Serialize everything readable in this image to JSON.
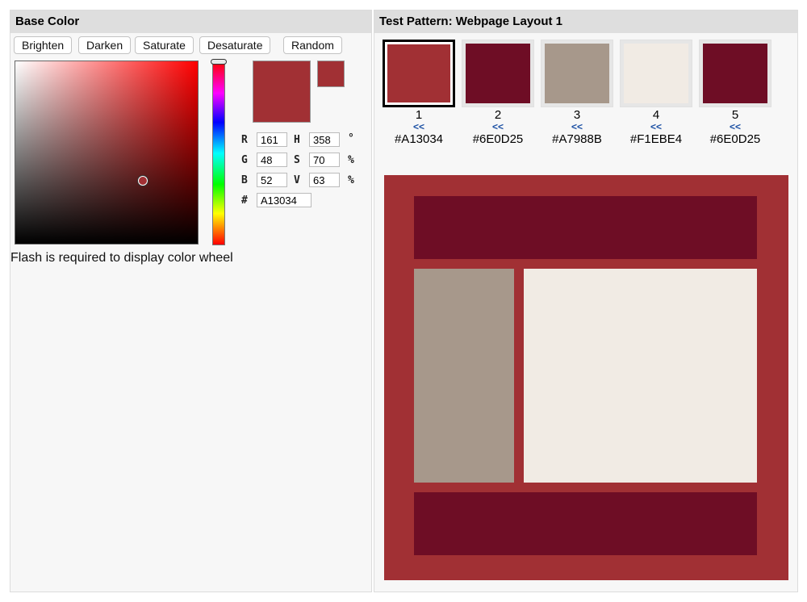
{
  "base_color": {
    "title": "Base Color",
    "buttons": [
      "Brighten",
      "Darken",
      "Saturate",
      "Desaturate",
      "Random"
    ],
    "current_color": "#A13034",
    "hue_base_color": "#FF0000",
    "fields": {
      "r_label": "R",
      "r_value": "161",
      "g_label": "G",
      "g_value": "48",
      "b_label": "B",
      "b_value": "52",
      "h_label": "H",
      "h_value": "358",
      "h_unit": "°",
      "s_label": "S",
      "s_value": "70",
      "s_unit": "%",
      "v_label": "V",
      "v_value": "63",
      "v_unit": "%",
      "hex_label": "#",
      "hex_value": "A13034"
    },
    "flash_message": "Flash is required to display color wheel"
  },
  "test_pattern": {
    "title": "Test Pattern: Webpage Layout 1",
    "move_icon": "double-left-arrow",
    "palette": [
      {
        "num": "1",
        "arrow": "<<",
        "hex": "#A13034",
        "color": "#A13034",
        "selected": true
      },
      {
        "num": "2",
        "arrow": "<<",
        "hex": "#6E0D25",
        "color": "#6E0D25",
        "selected": false
      },
      {
        "num": "3",
        "arrow": "<<",
        "hex": "#A7988B",
        "color": "#A7988B",
        "selected": false
      },
      {
        "num": "4",
        "arrow": "<<",
        "hex": "#F1EBE4",
        "color": "#F1EBE4",
        "selected": false
      },
      {
        "num": "5",
        "arrow": "<<",
        "hex": "#6E0D25",
        "color": "#6E0D25",
        "selected": false
      }
    ],
    "layout_colors": {
      "background": "#A13034",
      "header": "#6E0D25",
      "sidebar": "#A7988B",
      "content": "#F1EBE4",
      "footer": "#6E0D25"
    }
  }
}
